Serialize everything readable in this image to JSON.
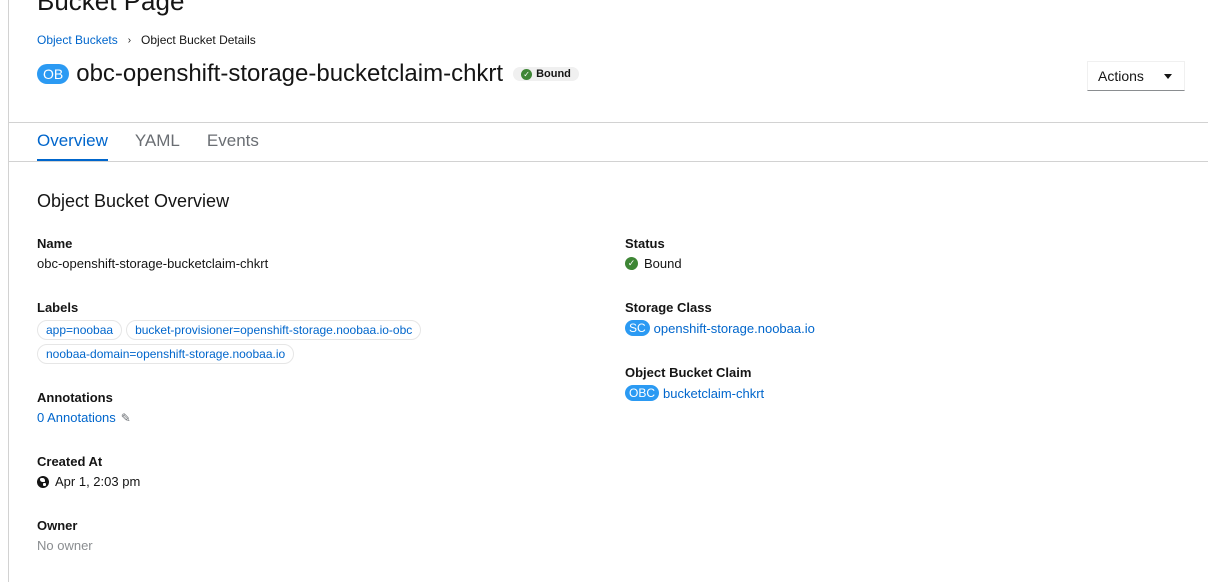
{
  "page_header_partial": "Bucket Page",
  "breadcrumb": {
    "parent_label": "Object Buckets",
    "separator": "›",
    "current_label": "Object Bucket Details"
  },
  "header": {
    "resource_badge": "OB",
    "title": "obc-openshift-storage-bucketclaim-chkrt",
    "status": "Bound",
    "actions_label": "Actions"
  },
  "tabs": [
    {
      "label": "Overview",
      "active": true
    },
    {
      "label": "YAML",
      "active": false
    },
    {
      "label": "Events",
      "active": false
    }
  ],
  "overview": {
    "section_title": "Object Bucket Overview",
    "name": {
      "label": "Name",
      "value": "obc-openshift-storage-bucketclaim-chkrt"
    },
    "labels": {
      "label": "Labels",
      "items": [
        "app=noobaa",
        "bucket-provisioner=openshift-storage.noobaa.io-obc",
        "noobaa-domain=openshift-storage.noobaa.io"
      ]
    },
    "annotations": {
      "label": "Annotations",
      "value": "0 Annotations"
    },
    "created_at": {
      "label": "Created At",
      "value": "Apr 1, 2:03 pm"
    },
    "owner": {
      "label": "Owner",
      "value": "No owner"
    },
    "status": {
      "label": "Status",
      "value": "Bound"
    },
    "storage_class": {
      "label": "Storage Class",
      "badge": "SC",
      "value": "openshift-storage.noobaa.io"
    },
    "claim": {
      "label": "Object Bucket Claim",
      "badge": "OBC",
      "value": "bucketclaim-chkrt"
    }
  },
  "colors": {
    "link": "#0066cc",
    "badge_blue": "#2b9af3",
    "success_green": "#3e8635"
  },
  "icons": [
    "chevron-right-icon",
    "check-circle-icon",
    "caret-down-icon",
    "pencil-icon",
    "globe-icon"
  ]
}
